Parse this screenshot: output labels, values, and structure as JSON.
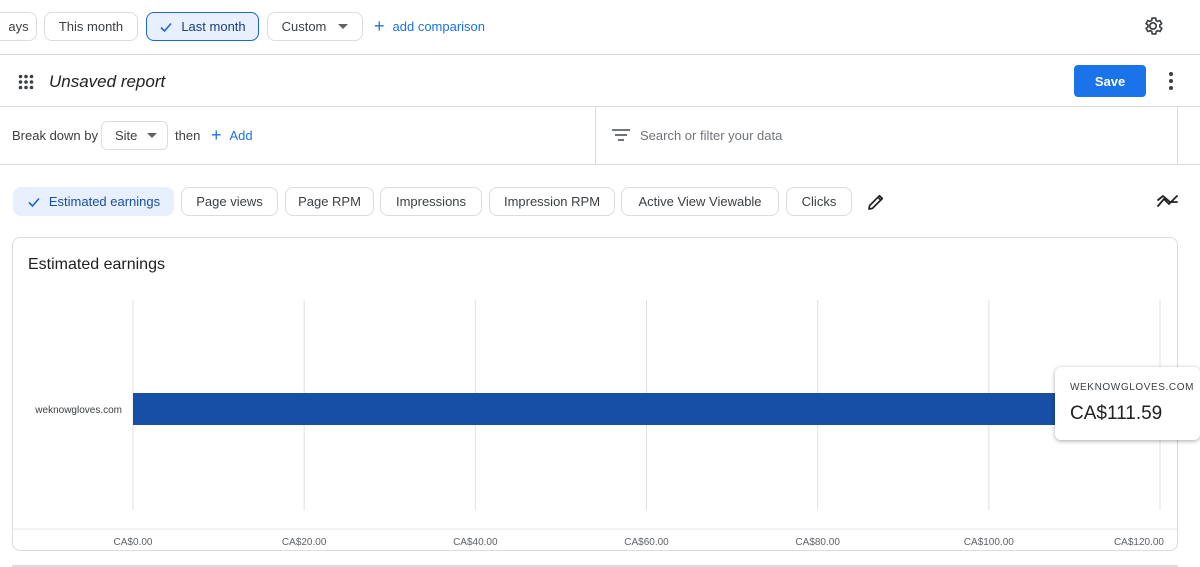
{
  "date_range": {
    "chips": [
      {
        "label": "ays",
        "selected": false
      },
      {
        "label": "This month",
        "selected": false
      },
      {
        "label": "Last month",
        "selected": true
      },
      {
        "label": "Custom",
        "selected": false
      }
    ],
    "add_comparison": "add comparison"
  },
  "report": {
    "title": "Unsaved report",
    "save_label": "Save"
  },
  "breakdown": {
    "label": "Break down by",
    "dimension": "Site",
    "then_label": "then",
    "add_label": "Add",
    "search_placeholder": "Search or filter your data"
  },
  "metrics": [
    {
      "label": "Estimated earnings",
      "selected": true
    },
    {
      "label": "Page views",
      "selected": false
    },
    {
      "label": "Page RPM",
      "selected": false
    },
    {
      "label": "Impressions",
      "selected": false
    },
    {
      "label": "Impression RPM",
      "selected": false
    },
    {
      "label": "Active View Viewable",
      "selected": false
    },
    {
      "label": "Clicks",
      "selected": false
    }
  ],
  "chart_data": {
    "type": "bar",
    "orientation": "horizontal",
    "title": "Estimated earnings",
    "categories": [
      "weknowgloves.com"
    ],
    "values": [
      111.59
    ],
    "xlim": [
      0,
      120
    ],
    "ticks": [
      0,
      20,
      40,
      60,
      80,
      100,
      120
    ],
    "tick_labels": [
      "CA$0.00",
      "CA$20.00",
      "CA$40.00",
      "CA$60.00",
      "CA$80.00",
      "CA$100.00",
      "CA$120.00"
    ],
    "grid": true,
    "bar_color": "#174ea6"
  },
  "tooltip": {
    "site": "WEKNOWGLOVES.COM",
    "value": "CA$111.59"
  },
  "colors": {
    "accent": "#1a73e8",
    "bar": "#174ea6",
    "selected_chip_bg": "#e8f0fe"
  }
}
